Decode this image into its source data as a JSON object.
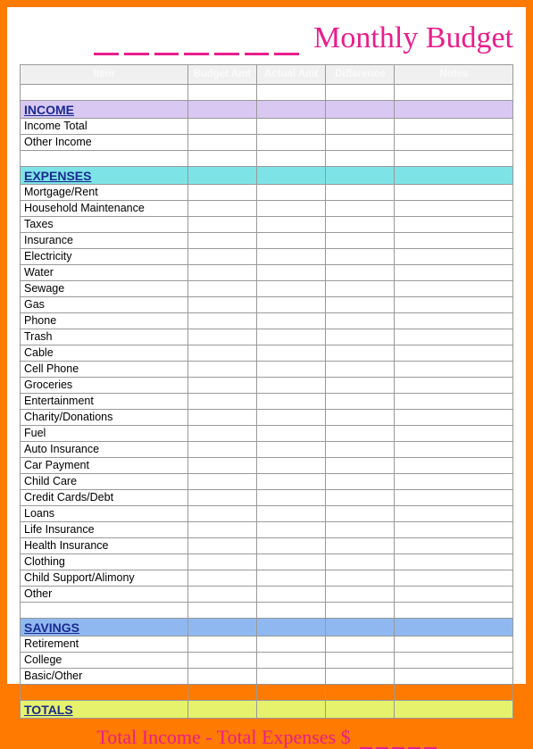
{
  "title": "Monthly Budget",
  "headers": {
    "item": "Item",
    "budget": "Budget Amt",
    "actual": "Actual Amt",
    "difference": "Difference",
    "notes": "Notes"
  },
  "sections": {
    "income": {
      "label": "INCOME",
      "rows": [
        "Income Total",
        "Other Income"
      ]
    },
    "expenses": {
      "label": "EXPENSES",
      "rows": [
        "Mortgage/Rent",
        "Household Maintenance",
        "Taxes",
        "Insurance",
        "Electricity",
        "Water",
        "Sewage",
        "Gas",
        "Phone",
        "Trash",
        "Cable",
        "Cell Phone",
        "Groceries",
        "Entertainment",
        "Charity/Donations",
        "Fuel",
        "Auto Insurance",
        "Car Payment",
        "Child Care",
        "Credit Cards/Debt",
        "Loans",
        "Life Insurance",
        "Health Insurance",
        "Clothing",
        "Child Support/Alimony",
        "Other"
      ]
    },
    "savings": {
      "label": "SAVINGS",
      "rows": [
        "Retirement",
        "College",
        "Basic/Other"
      ]
    },
    "totals": {
      "label": "TOTALS",
      "rows": []
    }
  },
  "footer": "Total Income - Total Expenses $"
}
